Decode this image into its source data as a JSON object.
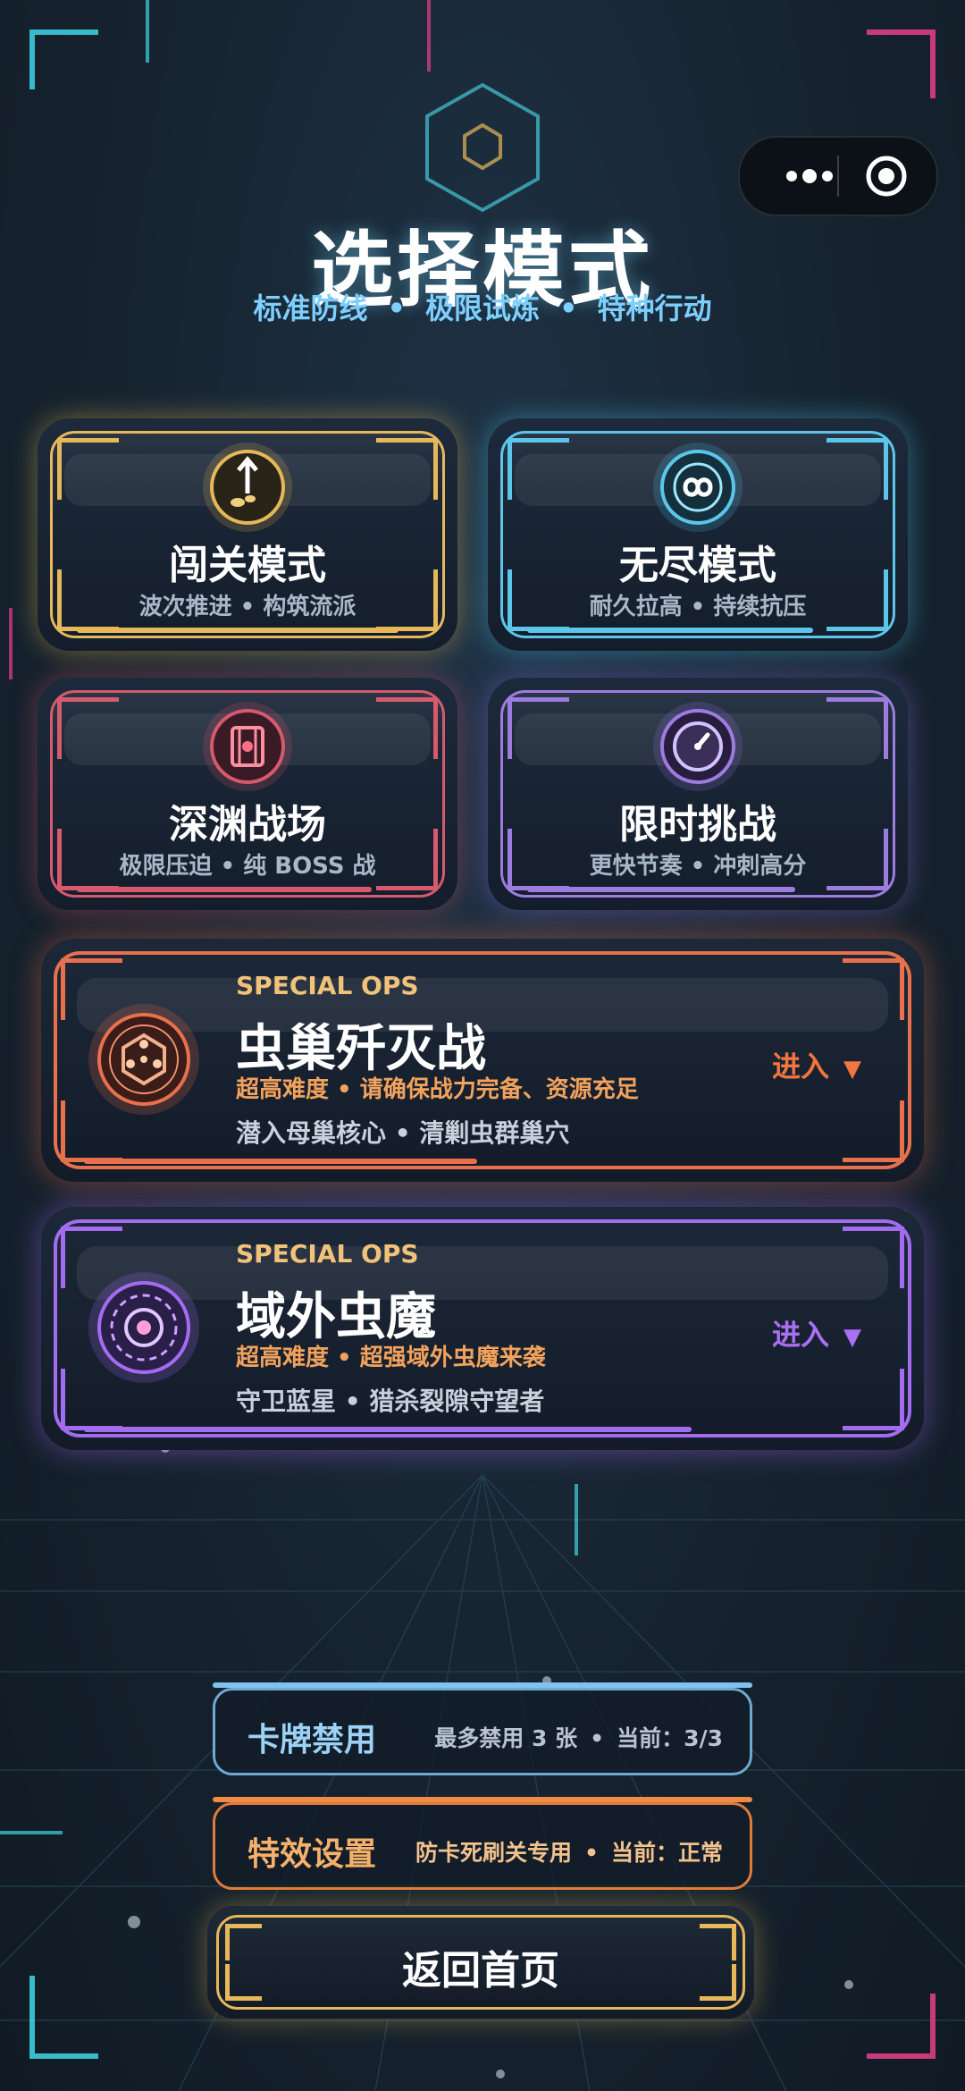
{
  "header": {
    "title": "选择模式",
    "subtitle_parts": [
      "标准防线",
      "极限试炼",
      "特种行动"
    ],
    "separator": "•"
  },
  "modes": [
    {
      "name": "闯关模式",
      "desc": "波次推进 • 构筑流派",
      "icon": "level-icon",
      "accent": "#e7b85a"
    },
    {
      "name": "无尽模式",
      "desc": "耐久拉高 • 持续抗压",
      "icon": "infinity-icon",
      "accent": "#5cc6ea"
    },
    {
      "name": "深渊战场",
      "desc": "极限压迫 • 纯 BOSS 战",
      "icon": "abyss-icon",
      "accent": "#d65a6e"
    },
    {
      "name": "限时挑战",
      "desc": "更快节奏 • 冲刺高分",
      "icon": "clock-icon",
      "accent": "#9d7ce0"
    }
  ],
  "special_ops": [
    {
      "tag": "SPECIAL OPS",
      "name": "虫巢歼灭战",
      "warning": "超高难度 • 请确保战力完备、资源充足",
      "desc": "潜入母巢核心 • 清剿虫群巢穴",
      "enter": "进入",
      "accent": "#e8704c",
      "icon": "hive-icon"
    },
    {
      "tag": "SPECIAL OPS",
      "name": "域外虫魔",
      "warning": "超高难度 • 超强域外虫魔来袭",
      "desc": "守卫蓝星 • 猎杀裂隙守望者",
      "enter": "进入",
      "accent": "#a36cf0",
      "icon": "portal-icon"
    }
  ],
  "settings": {
    "card_ban": {
      "label": "卡牌禁用",
      "info_left": "最多禁用 3 张",
      "info_right": "当前：3/3",
      "accent": "#7fc4ef"
    },
    "effects": {
      "label": "特效设置",
      "info_left": "防卡死刷关专用",
      "info_right": "当前：正常",
      "accent": "#f08a44"
    }
  },
  "home_button": {
    "label": "返回首页"
  }
}
